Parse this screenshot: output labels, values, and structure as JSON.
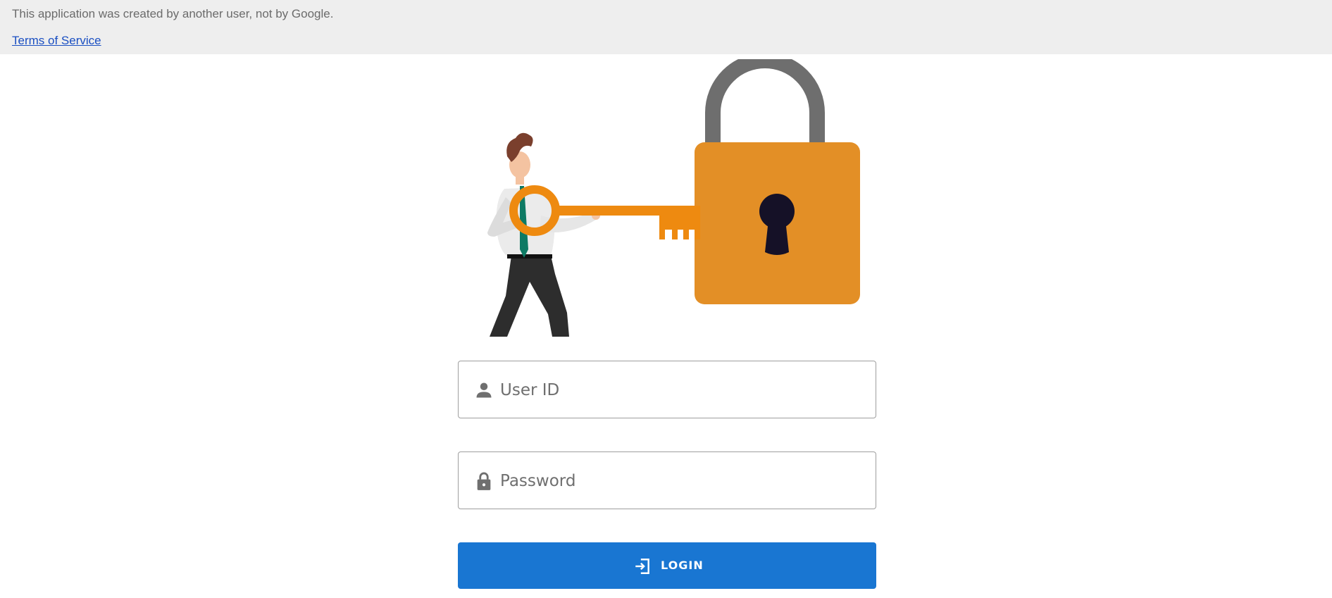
{
  "banner": {
    "notice": "This application was created by another user, not by Google.",
    "terms_link": "Terms of Service"
  },
  "illustration": {
    "description_icon": "man-with-key-and-padlock"
  },
  "form": {
    "user_id": {
      "icon": "person-icon",
      "placeholder": "User ID",
      "value": ""
    },
    "password": {
      "icon": "lock-icon",
      "placeholder": "Password",
      "value": ""
    },
    "login_button": {
      "icon": "login-icon",
      "label": "LOGIN"
    }
  },
  "colors": {
    "banner_bg": "#eeeeee",
    "link": "#1a4fc2",
    "padlock_body": "#e38f26",
    "padlock_shackle": "#6e6e6e",
    "key": "#ee8a10",
    "button": "#1976d2"
  }
}
